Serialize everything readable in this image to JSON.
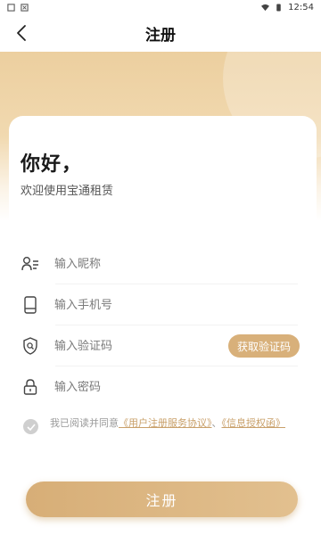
{
  "status_bar": {
    "time": "12:54"
  },
  "header": {
    "title": "注册"
  },
  "greeting": {
    "title": "你好，",
    "subtitle": "欢迎使用宝通租赁"
  },
  "form": {
    "nickname_placeholder": "输入昵称",
    "phone_placeholder": "输入手机号",
    "code_placeholder": "输入验证码",
    "password_placeholder": "输入密码",
    "get_code_label": "获取验证码"
  },
  "agreement": {
    "prefix": "我已阅读并同意",
    "link1": "《用户注册服务协议》",
    "separator": "、",
    "link2": "《信息授权函》",
    "checked": false
  },
  "submit_label": "注册",
  "colors": {
    "accent": "#d8b07a",
    "banner": "#eccf9f",
    "link": "#c9a06a"
  }
}
